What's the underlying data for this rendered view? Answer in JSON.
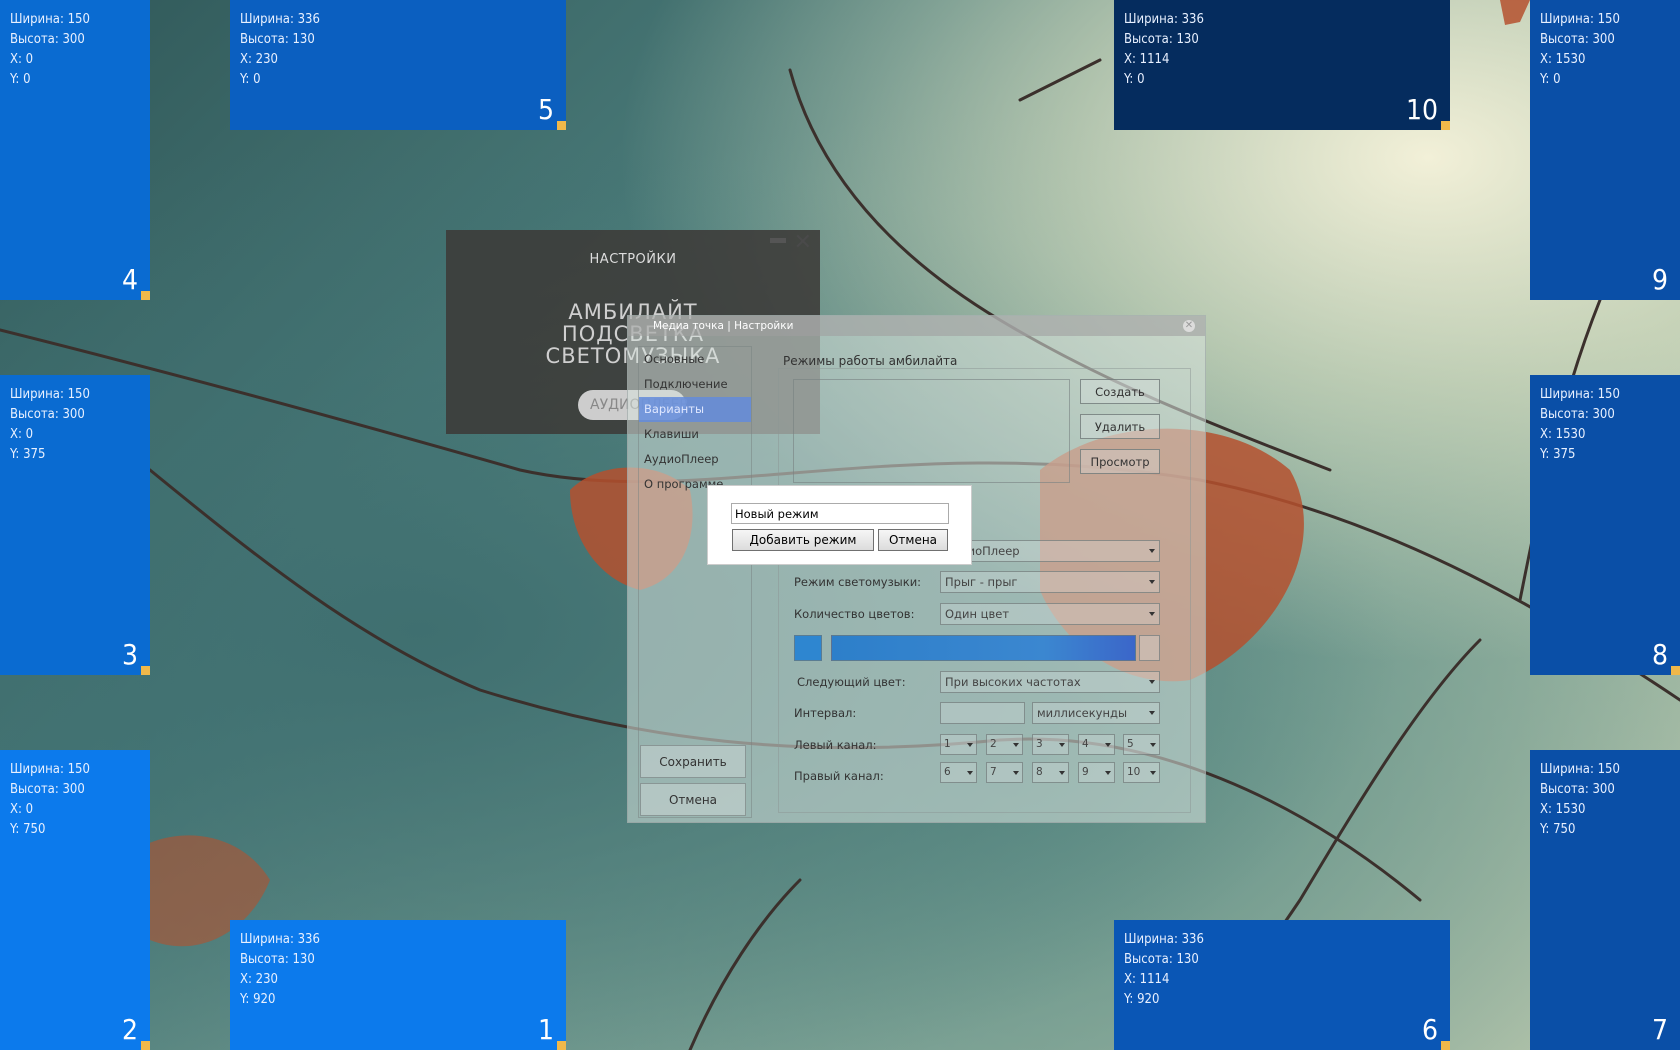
{
  "zones": [
    {
      "id": "4",
      "lines": [
        "Ширина: 150",
        "Высота: 300",
        "X: 0",
        "Y: 0"
      ],
      "color": "#0a6bd1"
    },
    {
      "id": "5",
      "lines": [
        "Ширина: 336",
        "Высота: 130",
        "X: 230",
        "Y: 0"
      ],
      "color": "#0b5fc0"
    },
    {
      "id": "10",
      "lines": [
        "Ширина: 336",
        "Высота: 130",
        "X: 1114",
        "Y: 0"
      ],
      "color": "#052c5e"
    },
    {
      "id": "9",
      "lines": [
        "Ширина: 150",
        "Высота: 300",
        "X: 1530",
        "Y: 0"
      ],
      "color": "#0a4fa7"
    },
    {
      "id": "3",
      "lines": [
        "Ширина: 150",
        "Высота: 300",
        "X: 0",
        "Y: 375"
      ],
      "color": "#0a6bd1"
    },
    {
      "id": "8",
      "lines": [
        "Ширина: 150",
        "Высота: 300",
        "X: 1530",
        "Y: 375"
      ],
      "color": "#0a4fa7"
    },
    {
      "id": "2",
      "lines": [
        "Ширина: 150",
        "Высота: 300",
        "X: 0",
        "Y: 750"
      ],
      "color": "#0c7aec"
    },
    {
      "id": "7",
      "lines": [
        "Ширина: 150",
        "Высота: 300",
        "X: 1530",
        "Y: 750"
      ],
      "color": "#0a4fa7"
    },
    {
      "id": "1",
      "lines": [
        "Ширина: 336",
        "Высота: 130",
        "X: 230",
        "Y: 920"
      ],
      "color": "#0c7aec"
    },
    {
      "id": "6",
      "lines": [
        "Ширина: 336",
        "Высота: 130",
        "X: 1114",
        "Y: 920"
      ],
      "color": "#0a56b5"
    }
  ],
  "hud": {
    "title": "НАСТРОЙКИ",
    "modes": [
      "АМБИЛАЙТ",
      "ПОДСВЕТКА",
      "СВЕТОМУЗЫКА"
    ],
    "audio": "АУДИОПЛЕЕР"
  },
  "window": {
    "title": "Медиа точка | Настройки",
    "nav": [
      "Основные",
      "Подключение",
      "Варианты",
      "Клавиши",
      "АудиоПлеер",
      "О программе"
    ],
    "selected_nav": "Варианты",
    "save": "Сохранить",
    "cancel": "Отмена",
    "group_title": "Режимы работы амбилайта",
    "create": "Создать",
    "delete": "Удалить",
    "preview": "Просмотр",
    "source_value": "АудиоПлеер",
    "music_mode_label": "Режим светомузыки:",
    "music_mode_value": "Прыг - прыг",
    "colors_label": "Количество цветов:",
    "colors_value": "Один цвет",
    "next_color_label": "Следующий цвет:",
    "next_color_value": "При высоких частотах",
    "interval_label": "Интервал:",
    "interval_value": "",
    "interval_unit": "миллисекунды",
    "left_label": "Левый канал:",
    "right_label": "Правый канал:",
    "left_channels": [
      "1",
      "2",
      "3",
      "4",
      "5"
    ],
    "right_channels": [
      "6",
      "7",
      "8",
      "9",
      "10"
    ],
    "color_hex": "#2e86d0"
  },
  "dialog": {
    "input_value": "Новый режим",
    "add": "Добавить режим",
    "cancel": "Отмена"
  }
}
